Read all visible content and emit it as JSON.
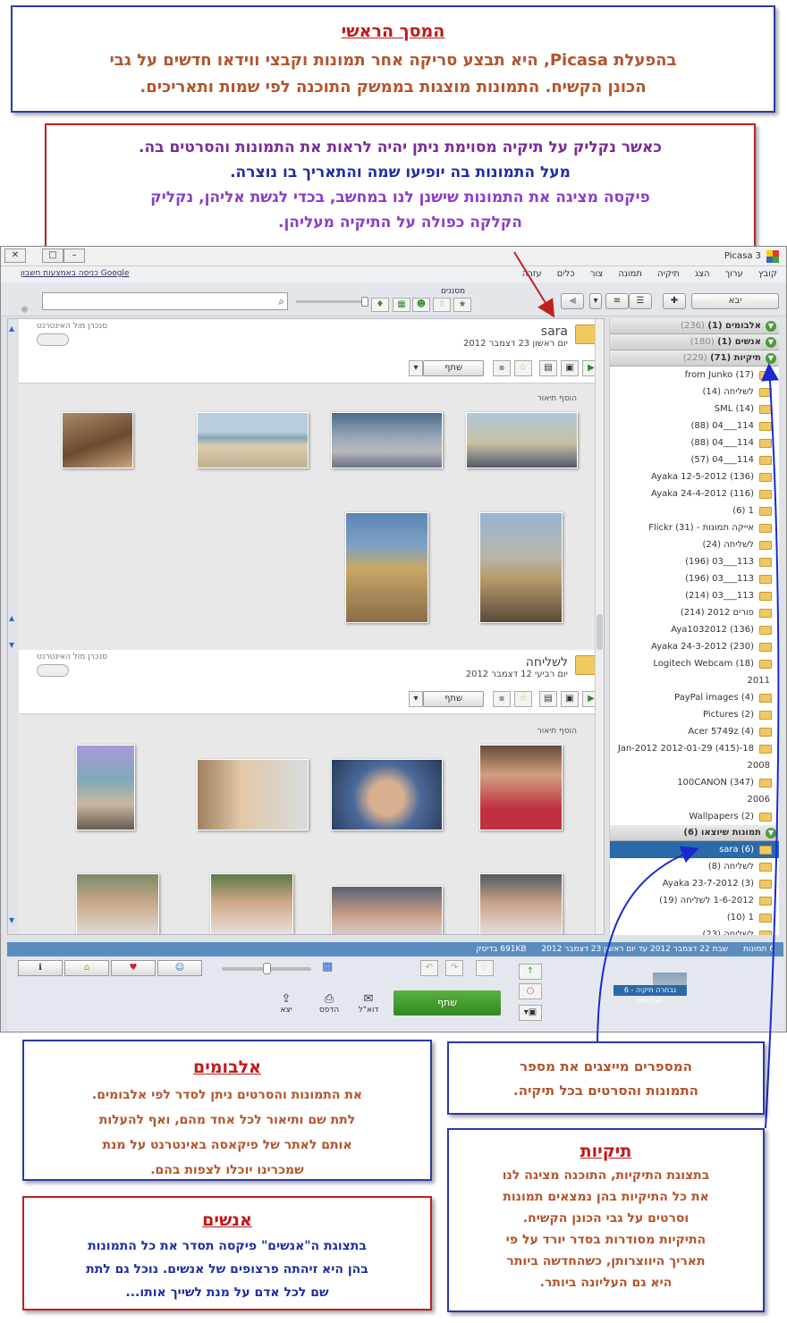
{
  "callouts": {
    "main": {
      "title": "המסך הראשי",
      "l1": "בהפעלת Picasa, היא תבצע סריקה אחר תמונות וקבצי ווידאו חדשים על גבי",
      "l2": "הכונן הקשיח. התמונות מוצגות בממשק התוכנה לפי שמות ותאריכים."
    },
    "folder": {
      "l1": "כאשר נקליק על תיקיה מסוימת ניתן יהיה לראות את התמונות והסרטים בה.",
      "l2": "מעל התמונות בה יופיעו שמה והתאריך בו נוצרה.",
      "l3": "פיקסה מציגה את התמונות שישנן לנו במחשב, בכדי לגשת אליהן, נקליק",
      "l4": "הקלקה כפולה על התיקיה מעליהן."
    },
    "albums": {
      "title": "אלבומים",
      "l1": "את התמונות והסרטים ניתן לסדר לפי אלבומים.",
      "l2": "לתת שם ותיאור לכל אחד מהם, ואף להעלות",
      "l3": "אותם לאתר של פיקאסה באינטרנט על מנת",
      "l4": "שמכרינו יוכלו לצפות בהם."
    },
    "people": {
      "title": "אנשים",
      "l1": "בתצוגת ה\"אנשים\" פיקסה תסדר את כל התמונות",
      "l2": "בהן היא זיהתה פרצופים של אנשים. נוכל גם לתת",
      "l3": "שם לכל אדם על מנת לשייך אותו..."
    },
    "numbers": {
      "l1": "המספרים מייצגים את מספר",
      "l2": "התמונות והסרטים בכל תיקיה."
    },
    "folders": {
      "title": "תיקיות",
      "l1": "בתצוגת התיקיות, התוכנה מציגה לנו",
      "l2": "את כל התיקיות בהן נמצאים תמונות",
      "l3": "וסרטים על גבי הכונן הקשיח.",
      "l4": "התיקיות מסודרות בסדר יורד על פי",
      "l5": "תאריך היווצרותן, כשהחדשה ביותר",
      "l6": "היא גם העליונה ביותר."
    }
  },
  "window": {
    "title": "Picasa 3",
    "signin": "כניסה באמצעות חשבון Google"
  },
  "menu": [
    "קובץ",
    "ערוך",
    "הצג",
    "תיקיה",
    "תמונה",
    "צור",
    "כלים",
    "עזרה"
  ],
  "toolbar": {
    "import": "יבא",
    "filters": "מסננים"
  },
  "library": {
    "albums": {
      "label": "אלבומים (1)",
      "count": "(236)"
    },
    "people": {
      "label": "אנשים (1)",
      "count": "(180)"
    },
    "folders": {
      "label": "תיקיות (71)",
      "count": "(229)"
    },
    "folder_items": [
      "from Junko (17)",
      "לשליחה (14)",
      "SML (14)",
      "114___04 (88)",
      "114___04 (88)",
      "114___04 (57)",
      "Ayaka 12-5-2012 (136)",
      "Ayaka 24-4-2012 (116)",
      "1 (6)",
      "אייקה תמונות - Flickr (31)",
      "לשליחה (24)",
      "113___03 (196)",
      "113___03 (196)",
      "113___03 (214)",
      "פורים 2012 (214)",
      "Aya1032012 (136)",
      "Ayaka 24-3-2012 (230)",
      "Logitech Webcam (18)"
    ],
    "year_2011": "2011",
    "items_2011": [
      "PayPal images (4)",
      "Pictures (2)",
      "Acer 5749z (4)",
      "18-Jan-2012 2012-01-29 (415)"
    ],
    "year_2008": "2008",
    "items_2008": [
      "100CANON (347)"
    ],
    "year_2006": "2006",
    "items_2006": [
      "Wallpapers (2)"
    ],
    "exported": {
      "label": "תמונות שיוצאו (6)"
    },
    "exported_items": [
      "sara (6)",
      "לשליחה (8)",
      "Ayaka 23-7-2012 (3)",
      "1-6-2012 לשליחה (19)",
      "1 (10)",
      "לשליחה (23)"
    ]
  },
  "folder1": {
    "name": "sara",
    "date": "יום ראשון 23 דצמבר 2012",
    "sync": "סנכרן מול האינטרנט",
    "share": "שתף",
    "caption": "הוסף תיאור"
  },
  "folder2": {
    "name": "לשליחה",
    "date": "יום רביעי 12 דצמבר 2012",
    "sync": "סנכרן מול האינטרנט",
    "share": "שתף",
    "caption": "הוסף תיאור"
  },
  "status": {
    "count": "6 תמונות",
    "range": "שבת 22 דצמבר 2012 עד יום ראשון 23 דצמבר 2012",
    "size": "691KB בדיסק"
  },
  "bottom": {
    "share": "שתף",
    "email": "דוא\"ל",
    "print": "הדפס",
    "export": "יצא",
    "tray": "נבחרה תיקיה - 6 תצלומים"
  },
  "colors": {
    "accent_blue": "#2a6aa8",
    "share_green": "#3f9c2c",
    "callout_red": "#c01818",
    "callout_brown": "#b4542c"
  }
}
